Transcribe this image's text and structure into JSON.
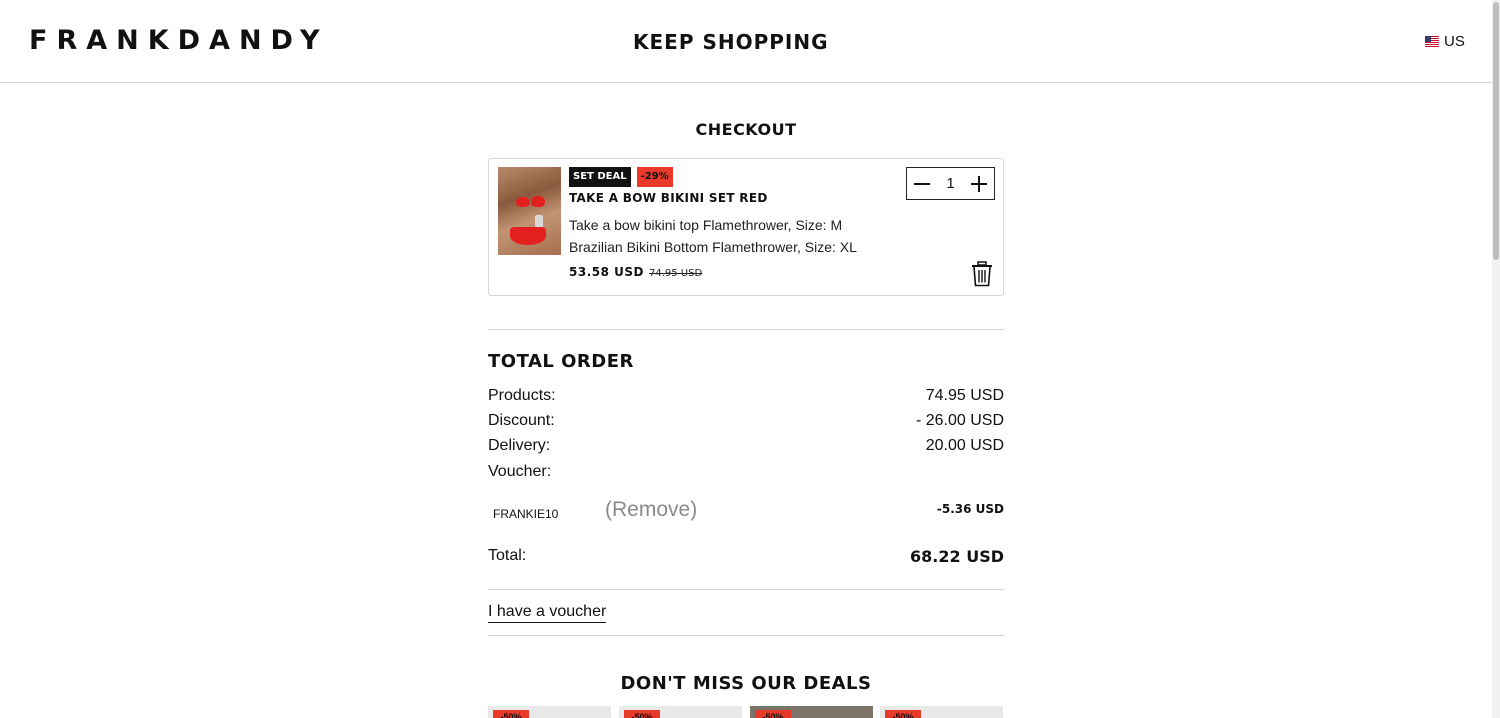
{
  "header": {
    "logo": "FRANKDANDY",
    "center_link": "KEEP SHOPPING",
    "country": "US"
  },
  "checkout": {
    "title": "CHECKOUT",
    "item": {
      "badge_deal": "SET DEAL",
      "badge_discount": "-29%",
      "name": "TAKE A BOW BIKINI SET RED",
      "variant_1": "Take a bow bikini top Flamethrower, Size: M",
      "variant_2": "Brazilian Bikini Bottom Flamethrower, Size: XL",
      "price_now": "53.58 USD",
      "price_was": "74.95 USD",
      "quantity": "1"
    }
  },
  "total_order": {
    "title": "TOTAL ORDER",
    "products_label": "Products:",
    "products_value": "74.95 USD",
    "discount_label": "Discount:",
    "discount_value": "- 26.00 USD",
    "delivery_label": "Delivery:",
    "delivery_value": "20.00 USD",
    "voucher_label": "Voucher:",
    "voucher_code": "FRANKIE10",
    "voucher_remove": "(Remove)",
    "voucher_value": "-5.36 USD",
    "total_label": "Total:",
    "total_value": "68.22 USD",
    "have_voucher": "I have a voucher"
  },
  "deals": {
    "title": "DON'T MISS OUR DEALS",
    "cards": [
      {
        "badge": "-50%"
      },
      {
        "badge": "-50%"
      },
      {
        "badge": "-50%"
      },
      {
        "badge": "-50%"
      }
    ]
  },
  "colors": {
    "accent_red": "#e8392b",
    "text": "#111111",
    "divider": "#d6d6d6",
    "muted": "#8a8a8a"
  }
}
